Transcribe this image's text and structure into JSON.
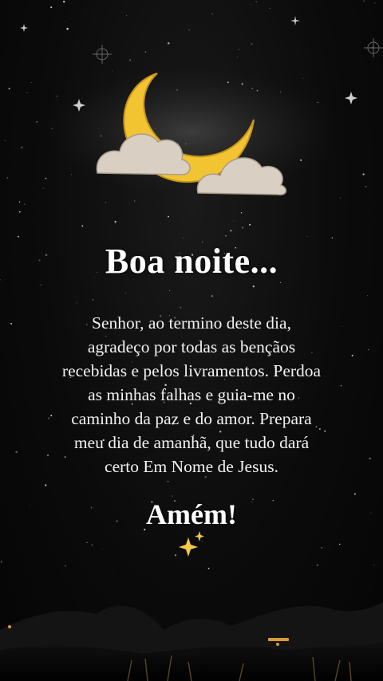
{
  "greeting": "Boa noite...",
  "prayer_lines": [
    "Senhor, ao termino deste dia,",
    "agradeço por todas as bençãos",
    "recebidas e pelos livramentos. Perdoa",
    "as minhas falhas e guia-me no",
    "caminho da paz e do amor. Prepara",
    "meu dia de amanhã, que tudo dará",
    "certo Em Nome de Jesus."
  ],
  "closing": "Amém!",
  "colors": {
    "moon": "#f2c432",
    "cloud": "#d9cfc2",
    "sky": "#0b0b0b",
    "sparkle": "#f5c84a"
  },
  "icons": {
    "moon": "crescent-moon-icon",
    "clouds": "cloud-icon",
    "sparkles": "sparkles-icon"
  }
}
